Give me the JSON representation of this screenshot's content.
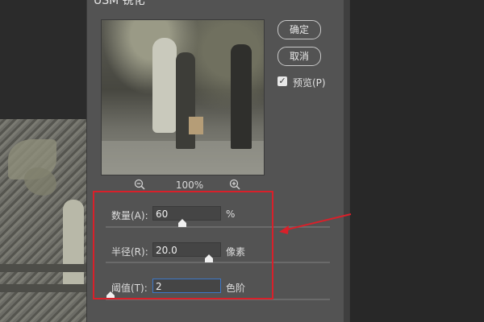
{
  "dialog": {
    "title": "USM 锐化",
    "ok_label": "确定",
    "cancel_label": "取消",
    "preview_label": "预览(P)",
    "preview_checked": true
  },
  "zoom": {
    "level": "100%",
    "zoom_out_icon": "zoom-out-icon",
    "zoom_in_icon": "zoom-in-icon"
  },
  "params": [
    {
      "label": "数量(A):",
      "value": "60",
      "unit": "%",
      "slider_fraction": 0.34
    },
    {
      "label": "半径(R):",
      "value": "20.0",
      "unit": "像素",
      "slider_fraction": 0.46
    },
    {
      "label": "阈值(T):",
      "value": "2",
      "unit": "色阶",
      "slider_fraction": 0.02
    }
  ],
  "annotation": {
    "highlight_color": "#d9202a"
  }
}
